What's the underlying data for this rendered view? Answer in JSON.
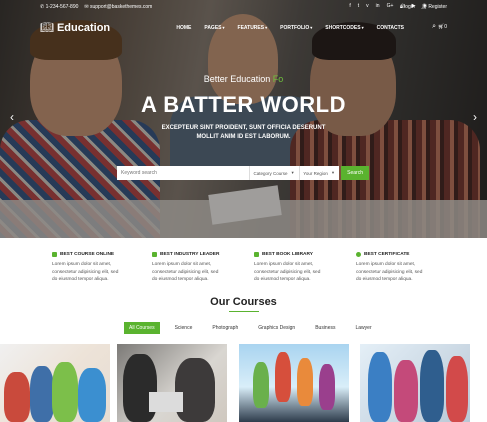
{
  "topbar": {
    "phone": "1-234-567-890",
    "email": "support@baskethemes.com",
    "social_icons": [
      "facebook-icon",
      "twitter-icon",
      "vimeo-icon",
      "linkedin-icon",
      "google-plus-icon",
      "github-icon",
      "youtube-icon",
      "dribbble-icon"
    ],
    "social_glyphs": [
      "f",
      "t",
      "v",
      "in",
      "G+",
      "◎",
      "▶",
      "◉"
    ],
    "login": "login",
    "register": "Register"
  },
  "nav": {
    "logo_text": "Education",
    "items": [
      {
        "label": "HOME",
        "caret": false
      },
      {
        "label": "PAGES",
        "caret": true
      },
      {
        "label": "FEATURES",
        "caret": true
      },
      {
        "label": "PORTFOLIO",
        "caret": true
      },
      {
        "label": "SHORTCODES",
        "caret": true
      },
      {
        "label": "CONTACTS",
        "caret": false
      }
    ],
    "cart_count": "0"
  },
  "hero": {
    "subtitle": "Better Education",
    "subtitle_accent": "Fo",
    "title": "A BATTER WORLD",
    "lead_line1": "EXCEPTEUR SINT PROIDENT, SUNT OFFICIA DESERUNT",
    "lead_line2": "MOLLIT ANIM ID EST LABORUM."
  },
  "search": {
    "placeholder": "Keyword search",
    "course_label": "Category Course",
    "region_label": "Your Region",
    "button": "Search"
  },
  "features": [
    {
      "title": "BEST COURSE ONLINE",
      "text1": "Lorem ipsum dolor sit amet,",
      "text2": "consectetur adipisicing elit, sed",
      "text3": "do eiusmod tempor aliqua."
    },
    {
      "title": "BEST INDUSTRY LEADER",
      "text1": "Lorem ipsum dolor sit amet,",
      "text2": "consectetur adipisicing elit, sed",
      "text3": "do eiusmod tempor aliqua."
    },
    {
      "title": "BEST BOOK LIBRARY",
      "text1": "Lorem ipsum dolor sit amet,",
      "text2": "consectetur adipisicing elit, sed",
      "text3": "do eiusmod tempor aliqua."
    },
    {
      "title": "BEST CERTIFICATE",
      "text1": "Lorem ipsum dolor sit amet,",
      "text2": "consectetur adipisicing elit, sed",
      "text3": "do eiusmod tempor aliqua."
    }
  ],
  "courses": {
    "title": "Our Courses",
    "tabs": [
      "All Courses",
      "Science",
      "Photograph",
      "Graphics Design",
      "Business",
      "Lawyer"
    ],
    "active_tab": "All Courses"
  },
  "colors": {
    "accent": "#5ab32f"
  }
}
